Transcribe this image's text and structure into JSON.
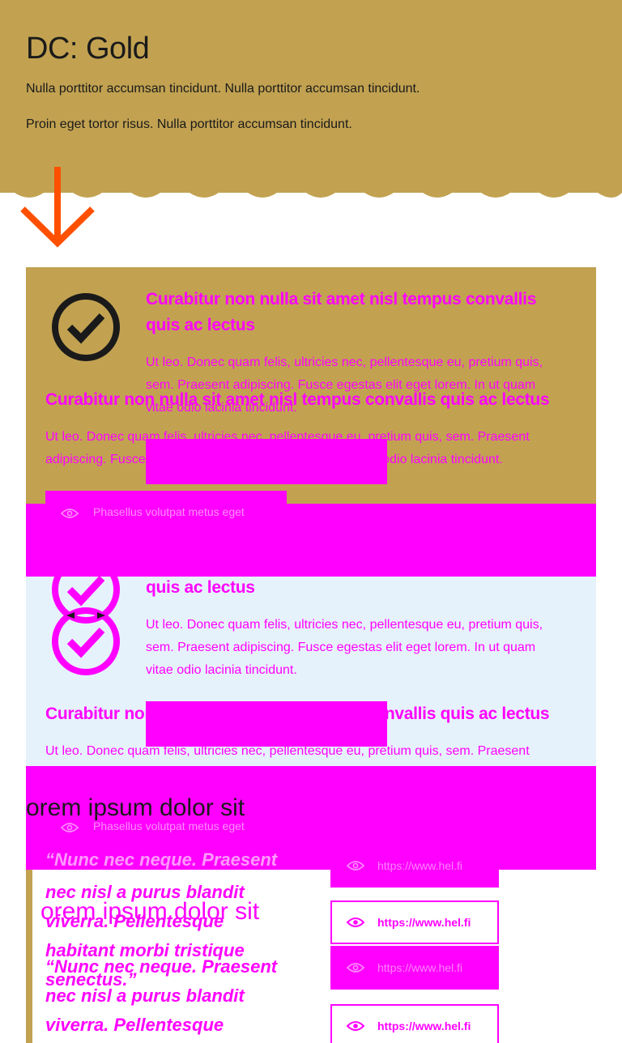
{
  "hero": {
    "title": "DC: Gold",
    "paragraph1": "Nulla porttitor accumsan tincidunt. Nulla porttitor accumsan tincidunt.",
    "paragraph2": "Proin eget tortor risus. Nulla porttitor accumsan tincidunt.",
    "background": "#c2a251",
    "arrow_color": "#ff5000"
  },
  "card_gold": {
    "heading_a": "Curabitur non nulla sit amet nisl tempus convallis",
    "heading_b": "quis ac lectus",
    "body_a": "Ut leo. Donec quam felis, ultricies nec, pellentesque eu, pretium quis,",
    "body_b": "sem. Praesent adipiscing. Fusce egestas elit eget lorem. In ut quam",
    "body_c": "vitae odio lacinia tincidunt.",
    "overlay_heading": "Curabitur non nulla sit amet nisl tempus convallis quis ac lectus",
    "overlay_body_a": "Ut leo. Donec quam felis, ultricies nec, pellentesque eu, pretium quis, sem. Praesent",
    "overlay_body_b": "adipiscing. Fusce egestas elit eget lorem. In ut quam vitae odio lacinia tincidunt.",
    "pill_label": "Phasellus volutpat metus eget"
  },
  "card_light": {
    "heading_b": "quis ac lectus",
    "body_a": "Ut leo. Donec quam felis, ultricies nec, pellentesque eu, pretium quis,",
    "body_b": "sem. Praesent adipiscing. Fusce egestas elit eget lorem. In ut quam",
    "body_c": "vitae odio lacinia tincidunt.",
    "overlay_heading": "Curabitur non nulla sit amet nisl tempus convallis quis ac lectus",
    "overlay_body_a": "Ut leo. Donec quam felis, ultricies nec, pellentesque eu, pretium quis, sem. Praesent",
    "pill_label": "Phasellus volutpat metus eget"
  },
  "lower": {
    "lorem1": "orem ipsum dolor sit",
    "lorem2": "orem ipsum dolor sit",
    "quote_line1": "“Nunc nec neque. Praesent",
    "quote_line2": "nec nisl a purus blandit",
    "quote_line3": "viverra. Pellentesque",
    "quote_line4": "habitant morbi tristique",
    "quote_line5": "“Nunc nec neque. Praesent",
    "quote_line6": "senectus.”",
    "quote_line7": "nec nisl a purus blandit",
    "quote_line8": "viverra. Pellentesque",
    "links": [
      {
        "label": "https://www.hel.fi",
        "style": "filled"
      },
      {
        "label": "https://www.hel.fi",
        "style": "outline"
      },
      {
        "label": "https://www.hel.fi",
        "style": "filled"
      },
      {
        "label": "https://www.hel.fi",
        "style": "outline"
      }
    ]
  },
  "colors": {
    "magenta": "#ff00ff",
    "gold": "#c2a251",
    "light_blue": "#e6f2fb",
    "icon_dark": "#1a1a1a"
  },
  "icons": [
    "arrow-down-icon",
    "check-circle-icon",
    "eye-icon"
  ]
}
